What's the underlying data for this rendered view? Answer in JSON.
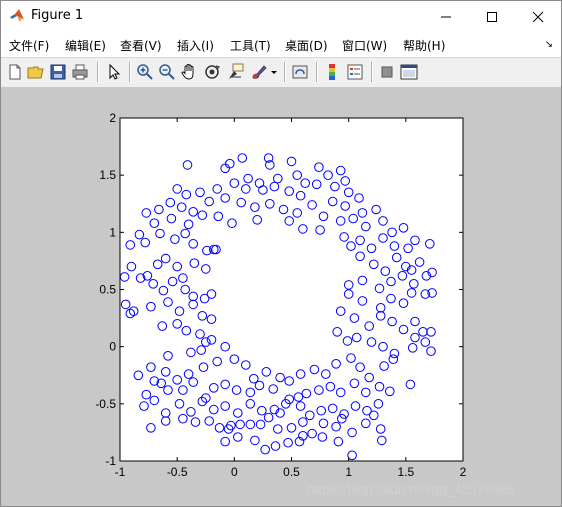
{
  "window": {
    "title": "Figure 1"
  },
  "menubar": {
    "items": [
      {
        "label": "文件(F)"
      },
      {
        "label": "编辑(E)"
      },
      {
        "label": "查看(V)"
      },
      {
        "label": "插入(I)"
      },
      {
        "label": "工具(T)"
      },
      {
        "label": "桌面(D)"
      },
      {
        "label": "窗口(W)"
      },
      {
        "label": "帮助(H)"
      }
    ],
    "overflow_arrow": "↘"
  },
  "toolbar": {
    "buttons": [
      {
        "name": "new-figure-icon"
      },
      {
        "name": "open-file-icon"
      },
      {
        "name": "save-figure-icon"
      },
      {
        "name": "print-figure-icon"
      },
      {
        "name": "edit-plot-arrow-icon"
      },
      {
        "name": "zoom-in-icon"
      },
      {
        "name": "zoom-out-icon"
      },
      {
        "name": "pan-hand-icon"
      },
      {
        "name": "rotate-3d-icon"
      },
      {
        "name": "data-cursor-icon"
      },
      {
        "name": "brush-icon"
      },
      {
        "name": "link-plot-icon"
      },
      {
        "name": "insert-colorbar-icon"
      },
      {
        "name": "insert-legend-icon"
      },
      {
        "name": "hide-plot-tools-icon"
      },
      {
        "name": "show-plot-tools-icon"
      }
    ]
  },
  "watermark": "https://blog.csdn.net/qq_42579966",
  "colors": {
    "canvas_bg": "#c8c8c8",
    "axes_bg": "#ffffff",
    "marker": "#0000ff"
  },
  "chart_data": {
    "type": "scatter",
    "marker": "circle-open",
    "xlim": [
      -1,
      2
    ],
    "ylim": [
      -1,
      2
    ],
    "x_ticks": [
      "-1",
      "-0.5",
      "0",
      "0.5",
      "1",
      "1.5",
      "2"
    ],
    "y_ticks": [
      "-1",
      "-0.5",
      "0",
      "0.5",
      "1",
      "1.5",
      "2"
    ],
    "grid": false,
    "series": [
      {
        "points": [
          [
            -0.04,
            1.6
          ],
          [
            0.07,
            1.65
          ],
          [
            0.3,
            1.65
          ],
          [
            0.5,
            1.62
          ],
          [
            0.74,
            1.57
          ],
          [
            0.93,
            1.54
          ],
          [
            -0.41,
            1.59
          ],
          [
            -0.08,
            1.56
          ],
          [
            0.12,
            1.47
          ],
          [
            0.22,
            1.43
          ],
          [
            0.31,
            1.59
          ],
          [
            0.38,
            1.47
          ],
          [
            0.55,
            1.5
          ],
          [
            0.62,
            1.43
          ],
          [
            0.82,
            1.5
          ],
          [
            0.97,
            1.45
          ],
          [
            -0.5,
            1.38
          ],
          [
            -0.42,
            1.33
          ],
          [
            -0.3,
            1.35
          ],
          [
            -0.15,
            1.38
          ],
          [
            0.0,
            1.43
          ],
          [
            0.1,
            1.38
          ],
          [
            0.25,
            1.37
          ],
          [
            0.35,
            1.4
          ],
          [
            0.48,
            1.36
          ],
          [
            0.58,
            1.32
          ],
          [
            0.72,
            1.42
          ],
          [
            0.88,
            1.4
          ],
          [
            1.0,
            1.35
          ],
          [
            1.09,
            1.3
          ],
          [
            -0.66,
            1.2
          ],
          [
            -0.56,
            1.26
          ],
          [
            -0.46,
            1.22
          ],
          [
            -0.36,
            1.18
          ],
          [
            -0.22,
            1.27
          ],
          [
            -0.08,
            1.3
          ],
          [
            0.06,
            1.26
          ],
          [
            0.18,
            1.22
          ],
          [
            0.31,
            1.25
          ],
          [
            0.43,
            1.2
          ],
          [
            0.55,
            1.17
          ],
          [
            0.68,
            1.24
          ],
          [
            0.78,
            1.14
          ],
          [
            0.86,
            1.27
          ],
          [
            0.97,
            1.23
          ],
          [
            1.12,
            1.17
          ],
          [
            1.24,
            1.2
          ],
          [
            -0.77,
            1.17
          ],
          [
            -0.7,
            1.08
          ],
          [
            -0.55,
            1.12
          ],
          [
            -0.4,
            1.07
          ],
          [
            -0.28,
            1.15
          ],
          [
            -0.14,
            1.14
          ],
          [
            -0.02,
            1.08
          ],
          [
            0.2,
            1.11
          ],
          [
            0.48,
            1.1
          ],
          [
            0.6,
            1.03
          ],
          [
            0.75,
            1.02
          ],
          [
            0.93,
            1.1
          ],
          [
            1.04,
            1.12
          ],
          [
            1.15,
            1.05
          ],
          [
            1.3,
            1.1
          ],
          [
            1.38,
            1.0
          ],
          [
            1.48,
            1.04
          ],
          [
            -0.91,
            0.89
          ],
          [
            -0.83,
            0.98
          ],
          [
            -0.78,
            0.91
          ],
          [
            -0.65,
            0.99
          ],
          [
            -0.52,
            0.94
          ],
          [
            -0.43,
            0.99
          ],
          [
            -0.36,
            0.9
          ],
          [
            -0.24,
            0.84
          ],
          [
            -0.16,
            0.85
          ],
          [
            0.96,
            0.96
          ],
          [
            1.02,
            0.88
          ],
          [
            1.1,
            0.93
          ],
          [
            1.2,
            0.86
          ],
          [
            1.3,
            0.95
          ],
          [
            1.4,
            0.88
          ],
          [
            1.52,
            0.86
          ],
          [
            1.58,
            0.93
          ],
          [
            1.71,
            0.9
          ],
          [
            -0.9,
            0.7
          ],
          [
            -0.76,
            0.62
          ],
          [
            -0.67,
            0.72
          ],
          [
            -0.6,
            0.77
          ],
          [
            -0.5,
            0.7
          ],
          [
            -0.45,
            0.6
          ],
          [
            -0.35,
            0.73
          ],
          [
            -0.25,
            0.68
          ],
          [
            1.1,
            0.79
          ],
          [
            1.22,
            0.72
          ],
          [
            1.32,
            0.66
          ],
          [
            1.42,
            0.78
          ],
          [
            1.5,
            0.7
          ],
          [
            1.62,
            0.74
          ],
          [
            -0.96,
            0.61
          ],
          [
            -0.82,
            0.6
          ],
          [
            -0.71,
            0.55
          ],
          [
            -0.62,
            0.49
          ],
          [
            -0.54,
            0.57
          ],
          [
            -0.43,
            0.5
          ],
          [
            -0.36,
            0.44
          ],
          [
            -0.26,
            0.42
          ],
          [
            -0.2,
            0.46
          ],
          [
            1.0,
            0.54
          ],
          [
            1.12,
            0.58
          ],
          [
            1.27,
            0.51
          ],
          [
            1.37,
            0.57
          ],
          [
            1.47,
            0.62
          ],
          [
            1.57,
            0.55
          ],
          [
            1.68,
            0.62
          ],
          [
            -0.95,
            0.37
          ],
          [
            -0.88,
            0.31
          ],
          [
            -0.91,
            0.29
          ],
          [
            -0.73,
            0.35
          ],
          [
            -0.58,
            0.39
          ],
          [
            -0.48,
            0.31
          ],
          [
            -0.36,
            0.37
          ],
          [
            -0.28,
            0.27
          ],
          [
            -0.2,
            0.24
          ],
          [
            1.0,
            0.46
          ],
          [
            1.12,
            0.4
          ],
          [
            1.28,
            0.34
          ],
          [
            1.37,
            0.42
          ],
          [
            1.48,
            0.38
          ],
          [
            1.55,
            0.47
          ],
          [
            1.67,
            0.46
          ],
          [
            1.73,
            0.47
          ],
          [
            -0.63,
            0.18
          ],
          [
            -0.5,
            0.2
          ],
          [
            -0.42,
            0.14
          ],
          [
            -0.3,
            0.11
          ],
          [
            -0.25,
            0.04
          ],
          [
            -0.2,
            0.06
          ],
          [
            0.93,
            0.31
          ],
          [
            1.05,
            0.25
          ],
          [
            1.18,
            0.18
          ],
          [
            1.28,
            0.27
          ],
          [
            1.38,
            0.22
          ],
          [
            1.48,
            0.15
          ],
          [
            1.58,
            0.22
          ],
          [
            1.65,
            0.13
          ],
          [
            1.72,
            0.13
          ],
          [
            -0.58,
            -0.08
          ],
          [
            -0.38,
            -0.05
          ],
          [
            -0.29,
            -0.03
          ],
          [
            -0.08,
            0.0
          ],
          [
            0.9,
            0.13
          ],
          [
            0.99,
            0.05
          ],
          [
            1.07,
            0.08
          ],
          [
            1.2,
            0.04
          ],
          [
            1.3,
            0.0
          ],
          [
            1.4,
            -0.06
          ],
          [
            1.56,
            -0.01
          ],
          [
            1.67,
            0.04
          ],
          [
            1.72,
            -0.04
          ],
          [
            -0.73,
            -0.18
          ],
          [
            -0.6,
            -0.22
          ],
          [
            -0.5,
            -0.29
          ],
          [
            -0.4,
            -0.24
          ],
          [
            -0.27,
            -0.18
          ],
          [
            -0.15,
            -0.13
          ],
          [
            0.0,
            -0.11
          ],
          [
            0.1,
            -0.16
          ],
          [
            0.17,
            -0.28
          ],
          [
            0.28,
            -0.22
          ],
          [
            0.4,
            -0.27
          ],
          [
            0.48,
            -0.3
          ],
          [
            0.58,
            -0.24
          ],
          [
            0.7,
            -0.2
          ],
          [
            0.8,
            -0.24
          ],
          [
            0.89,
            -0.15
          ],
          [
            1.02,
            -0.1
          ],
          [
            1.1,
            -0.18
          ],
          [
            1.18,
            -0.27
          ],
          [
            1.31,
            -0.17
          ],
          [
            1.39,
            -0.11
          ],
          [
            1.54,
            -0.33
          ],
          [
            -0.84,
            -0.25
          ],
          [
            -0.77,
            -0.42
          ],
          [
            -0.64,
            -0.32
          ],
          [
            -0.58,
            -0.38
          ],
          [
            -0.45,
            -0.38
          ],
          [
            -0.36,
            -0.31
          ],
          [
            -0.25,
            -0.45
          ],
          [
            -0.18,
            -0.36
          ],
          [
            -0.08,
            -0.33
          ],
          [
            0.02,
            -0.38
          ],
          [
            0.14,
            -0.4
          ],
          [
            0.22,
            -0.34
          ],
          [
            0.34,
            -0.37
          ],
          [
            0.48,
            -0.46
          ],
          [
            0.56,
            -0.44
          ],
          [
            0.63,
            -0.41
          ],
          [
            0.74,
            -0.38
          ],
          [
            0.84,
            -0.35
          ],
          [
            0.93,
            -0.4
          ],
          [
            1.05,
            -0.32
          ],
          [
            1.15,
            -0.4
          ],
          [
            1.27,
            -0.35
          ],
          [
            1.36,
            -0.39
          ],
          [
            -0.79,
            -0.52
          ],
          [
            -0.7,
            -0.47
          ],
          [
            -0.6,
            -0.58
          ],
          [
            -0.48,
            -0.5
          ],
          [
            -0.38,
            -0.57
          ],
          [
            -0.28,
            -0.48
          ],
          [
            -0.18,
            -0.55
          ],
          [
            -0.08,
            -0.52
          ],
          [
            0.03,
            -0.58
          ],
          [
            0.14,
            -0.5
          ],
          [
            0.24,
            -0.56
          ],
          [
            0.35,
            -0.55
          ],
          [
            0.45,
            -0.5
          ],
          [
            0.58,
            -0.52
          ],
          [
            0.66,
            -0.6
          ],
          [
            0.76,
            -0.56
          ],
          [
            0.86,
            -0.54
          ],
          [
            0.96,
            -0.59
          ],
          [
            1.06,
            -0.52
          ],
          [
            1.16,
            -0.56
          ],
          [
            1.26,
            -0.5
          ],
          [
            -0.73,
            -0.71
          ],
          [
            -0.6,
            -0.65
          ],
          [
            -0.45,
            -0.63
          ],
          [
            -0.34,
            -0.66
          ],
          [
            -0.22,
            -0.65
          ],
          [
            -0.13,
            -0.71
          ],
          [
            -0.03,
            -0.69
          ],
          [
            0.05,
            -0.68
          ],
          [
            0.14,
            -0.68
          ],
          [
            0.23,
            -0.68
          ],
          [
            0.3,
            -0.62
          ],
          [
            0.38,
            -0.72
          ],
          [
            0.5,
            -0.71
          ],
          [
            0.6,
            -0.66
          ],
          [
            0.68,
            -0.76
          ],
          [
            0.78,
            -0.67
          ],
          [
            0.89,
            -0.7
          ],
          [
            0.94,
            -0.63
          ],
          [
            1.03,
            -0.75
          ],
          [
            1.15,
            -0.67
          ],
          [
            1.28,
            -0.72
          ],
          [
            -0.08,
            -0.83
          ],
          [
            0.03,
            -0.79
          ],
          [
            0.18,
            -0.82
          ],
          [
            0.27,
            -0.9
          ],
          [
            0.36,
            -0.87
          ],
          [
            0.47,
            -0.84
          ],
          [
            0.57,
            -0.83
          ],
          [
            0.77,
            -0.79
          ],
          [
            0.91,
            -0.83
          ],
          [
            1.03,
            -0.95
          ],
          [
            1.29,
            -0.82
          ],
          [
            -0.05,
            -0.72
          ],
          [
            -0.18,
            0.85
          ],
          [
            1.73,
            0.65
          ],
          [
            -0.7,
            -0.3
          ],
          [
            0.4,
            -0.58
          ],
          [
            0.6,
            -0.78
          ],
          [
            1.22,
            -0.6
          ],
          [
            1.58,
            0.08
          ],
          [
            1.55,
            0.67
          ]
        ]
      }
    ]
  }
}
